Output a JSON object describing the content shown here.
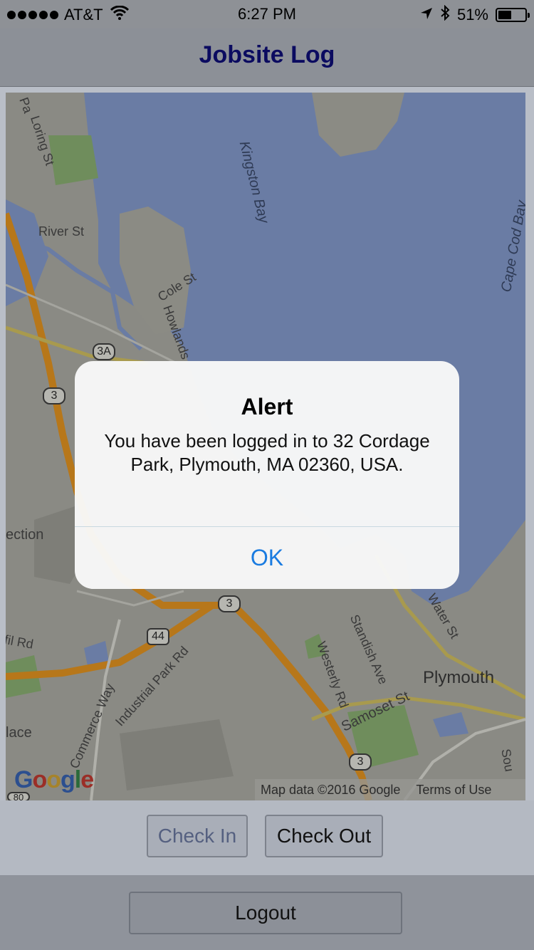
{
  "status_bar": {
    "carrier": "AT&T",
    "time": "6:27 PM",
    "battery": "51%",
    "battery_level": 0.51,
    "icons": [
      "signal-dots-icon",
      "wifi-icon",
      "location-arrow-icon",
      "bluetooth-icon",
      "battery-icon"
    ]
  },
  "nav": {
    "title": "Jobsite Log"
  },
  "map": {
    "labels": {
      "loring": "Loring St",
      "pa": "Pa",
      "river": "River St",
      "kingston_bay": "Kingston Bay",
      "cape_cod_bay": "Cape Cod Bay",
      "cole": "Cole St",
      "howlands": "Howlands",
      "ection": "ection",
      "rd": "fil Rd",
      "industrial": "Industrial Park Rd",
      "commerce": "Commerce Way",
      "lace": "lace",
      "westerly": "Westerly Rd",
      "standish": "Standish Ave",
      "water": "Water St",
      "samoset": "Samoset St",
      "plymouth": "Plymouth",
      "sou": "Sou"
    },
    "shields": {
      "r3a": "3A",
      "r3_a": "3",
      "r3_b": "3",
      "r3_c": "3",
      "r44": "44",
      "r80": "80"
    },
    "google": [
      "G",
      "o",
      "o",
      "g",
      "l",
      "e"
    ],
    "attribution": "Map data ©2016 Google",
    "terms": "Terms of Use",
    "colors": {
      "water": "#6b7ea6",
      "land": "#8b8b84",
      "highway": "#b7771a",
      "park": "#6f8d5c"
    }
  },
  "buttons": {
    "check_in": "Check In",
    "check_out": "Check Out",
    "logout": "Logout"
  },
  "alert": {
    "title": "Alert",
    "message": "You have been logged in to 32 Cordage Park, Plymouth, MA 02360, USA.",
    "ok": "OK",
    "accent": "#1a7be0"
  }
}
